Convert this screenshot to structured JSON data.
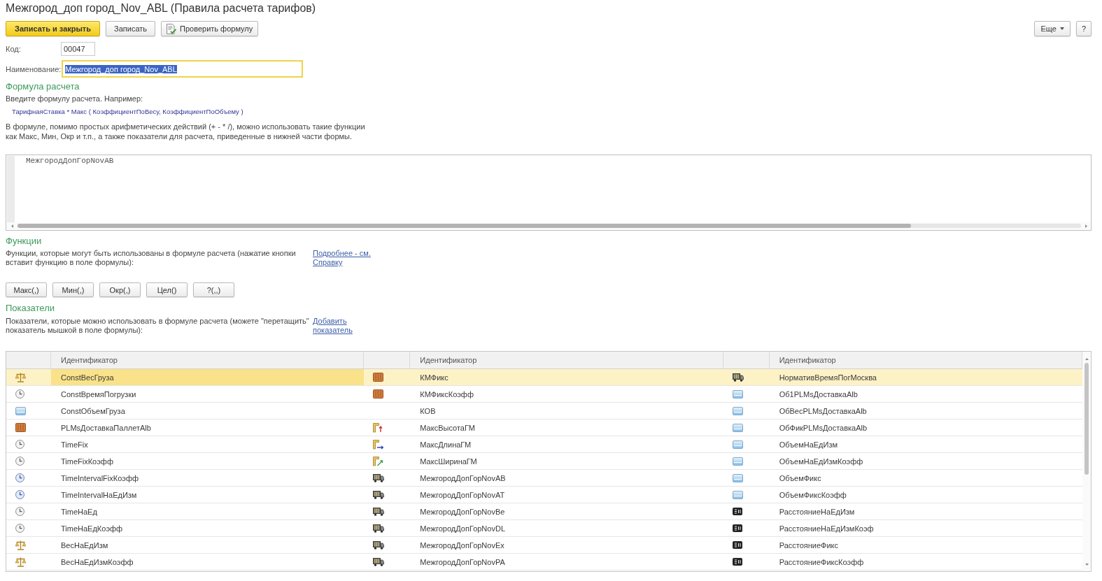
{
  "window": {
    "title": "Межгород_доп город_Nov_ABL (Правила расчета тарифов)"
  },
  "toolbar": {
    "buttons": [
      {
        "label": "Записать и закрыть",
        "kind": "primary"
      },
      {
        "label": "Записать",
        "kind": "plain"
      },
      {
        "label": "Проверить формулу",
        "kind": "check"
      }
    ],
    "right_buttons": [
      {
        "label": "Еще",
        "kind": "menu"
      },
      {
        "label": "?",
        "kind": "plain"
      }
    ]
  },
  "form": {
    "code": {
      "label": "Код:",
      "value": "00047"
    },
    "name": {
      "label": "Наименование:",
      "value": "Межгород_доп город_Nov_ABL",
      "focused": true,
      "value_selected": true
    }
  },
  "formula_section": {
    "heading": "Формула расчета",
    "hint": "Введите формулу расчета. Например:",
    "example": "ТарифнаяСтавка * Макс ( КоэффициентПоВесу, КоэффициентПоОбъему )",
    "note": "В формуле, помимо простых арифметических действий (+ - * /), можно использовать такие функции\nкак Макс, Мин, Окр и т.п., а также показатели для расчета, приведенные в нижней части формы.",
    "editor": {
      "value": "МежгородДопГорNovAB"
    }
  },
  "functions_section": {
    "heading": "Функции",
    "description": "Функции, которые могут быть использованы в формуле расчета (нажатие кнопки\nвставит функцию в поле формулы):",
    "link": "Подробнее - см. Справку",
    "buttons": [
      "Макс(,)",
      "Мин(,)",
      "Окр(,)",
      "Цел()",
      "?(,,)"
    ]
  },
  "indicators_section": {
    "heading": "Показатели",
    "description": "Показатели, которые можно использовать в формуле расчета (можете \"перетащить\"\nпоказатель мышкой в поле формулы):",
    "link": "Добавить показатель",
    "table": {
      "columns": [
        {
          "heading": "Идентификатор"
        },
        {
          "heading": "Идентификатор"
        },
        {
          "heading": "Идентификатор"
        }
      ],
      "rows": [
        {
          "selected": true,
          "cells": [
            {
              "kind": "weight",
              "text": "ConstВесГруза",
              "focused": true
            },
            {
              "kind": "crate",
              "text": "КМФикс",
              "focused": false
            },
            {
              "kind": "truck",
              "text": "НормативВремяПогМосква",
              "focused": false
            }
          ]
        },
        {
          "selected": false,
          "cells": [
            {
              "kind": "time",
              "text": "ConstВремяПогрузки",
              "focused": false
            },
            {
              "kind": "crate",
              "text": "КМФиксКоэфф",
              "focused": false
            },
            {
              "kind": "volume",
              "text": "Об1PLMsДоставкаAlb",
              "focused": false
            }
          ]
        },
        {
          "selected": false,
          "cells": [
            {
              "kind": "volume",
              "text": "ConstОбъемГруза",
              "focused": false
            },
            {
              "kind": "plain",
              "text": "КОВ",
              "focused": false
            },
            {
              "kind": "volume",
              "text": "ОбВесPLMsДоставкаAlb",
              "focused": false
            }
          ]
        },
        {
          "selected": false,
          "cells": [
            {
              "kind": "crate",
              "text": "PLMsДоставкаПаллетAlb",
              "focused": false
            },
            {
              "kind": "height",
              "text": "МаксВысотаГМ",
              "focused": false
            },
            {
              "kind": "volume",
              "text": "ОбФикPLMsДоставкаAlb",
              "focused": false
            }
          ]
        },
        {
          "selected": false,
          "cells": [
            {
              "kind": "time",
              "text": "TimeFix",
              "focused": false
            },
            {
              "kind": "length",
              "text": "МаксДлинаГМ",
              "focused": false
            },
            {
              "kind": "volume",
              "text": "ОбъемНаЕдИзм",
              "focused": false
            }
          ]
        },
        {
          "selected": false,
          "cells": [
            {
              "kind": "time",
              "text": "TimeFixКоэфф",
              "focused": false
            },
            {
              "kind": "width",
              "text": "МаксШиринаГМ",
              "focused": false
            },
            {
              "kind": "volume",
              "text": "ОбъемНаЕдИзмКоэфф",
              "focused": false
            }
          ]
        },
        {
          "selected": false,
          "cells": [
            {
              "kind": "interval",
              "text": "TimeIntervalFixКоэфф",
              "focused": false
            },
            {
              "kind": "truck",
              "text": "МежгородДопГорNovAB",
              "focused": false
            },
            {
              "kind": "volume",
              "text": "ОбъемФикс",
              "focused": false
            }
          ]
        },
        {
          "selected": false,
          "cells": [
            {
              "kind": "interval",
              "text": "TimeIntervalНаЕдИзм",
              "focused": false
            },
            {
              "kind": "truck",
              "text": "МежгородДопГорNovAT",
              "focused": false
            },
            {
              "kind": "volume",
              "text": "ОбъемФиксКоэфф",
              "focused": false
            }
          ]
        },
        {
          "selected": false,
          "cells": [
            {
              "kind": "time",
              "text": "TimeНаЕд",
              "focused": false
            },
            {
              "kind": "truck",
              "text": "МежгородДопГорNovBe",
              "focused": false
            },
            {
              "kind": "distance",
              "text": "РасстояниеНаЕдИзм",
              "focused": false
            }
          ]
        },
        {
          "selected": false,
          "cells": [
            {
              "kind": "time",
              "text": "TimeНаЕдКоэфф",
              "focused": false
            },
            {
              "kind": "truck",
              "text": "МежгородДопГорNovDL",
              "focused": false
            },
            {
              "kind": "distance",
              "text": "РасстояниеНаЕдИзмКоэф",
              "focused": false
            }
          ]
        },
        {
          "selected": false,
          "cells": [
            {
              "kind": "weight",
              "text": "ВесНаЕдИзм",
              "focused": false
            },
            {
              "kind": "truck",
              "text": "МежгородДопГорNovEx",
              "focused": false
            },
            {
              "kind": "distance",
              "text": "РасстояниеФикс",
              "focused": false
            }
          ]
        },
        {
          "selected": false,
          "cells": [
            {
              "kind": "weight",
              "text": "ВесНаЕдИзмКоэфф",
              "focused": false
            },
            {
              "kind": "truck",
              "text": "МежгородДопГорNovPA",
              "focused": false
            },
            {
              "kind": "distance",
              "text": "РасстояниеФиксКоэфф",
              "focused": false
            }
          ]
        }
      ]
    }
  }
}
